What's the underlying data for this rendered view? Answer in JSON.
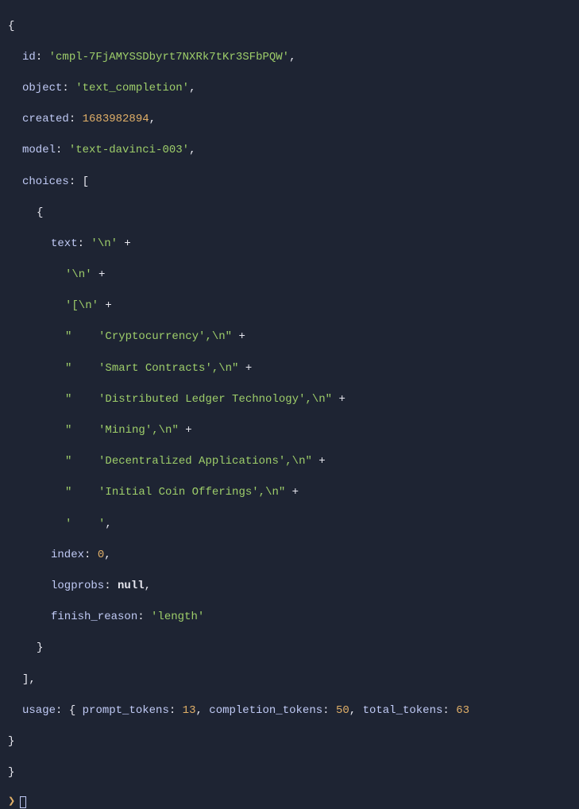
{
  "response": {
    "id_key": "id",
    "id_val": "'cmpl-7FjAMYSSDbyrt7NXRk7tKr3SFbPQW'",
    "object_key": "object",
    "object_val": "'text_completion'",
    "created_key": "created",
    "created_val": "1683982894",
    "model_key": "model",
    "model_val": "'text-davinci-003'",
    "choices_key": "choices",
    "choice": {
      "text_key": "text",
      "text_frag0": "'\\n'",
      "plus": " + ",
      "plus_trail": " +",
      "text_frag1": "'\\n'",
      "text_frag2": "'[\\n'",
      "text_line1a": "\"    '",
      "text_line1b": "Cryptocurrency",
      "text_line1c": "',\\n\"",
      "text_line2a": "\"    '",
      "text_line2b": "Smart Contracts",
      "text_line2c": "',\\n\"",
      "text_line3a": "\"    '",
      "text_line3b": "Distributed Ledger Technology",
      "text_line3c": "',\\n\"",
      "text_line4a": "\"    '",
      "text_line4b": "Mining",
      "text_line4c": "',\\n\"",
      "text_line5a": "\"    '",
      "text_line5b": "Decentralized Applications",
      "text_line5c": "',\\n\"",
      "text_line6a": "\"    '",
      "text_line6b": "Initial Coin Offerings",
      "text_line6c": "',\\n\"",
      "text_line7": "'    '",
      "index_key": "index",
      "index_val": "0",
      "logprobs_key": "logprobs",
      "logprobs_val": "null",
      "finish_reason_key": "finish_reason",
      "finish_reason_val": "'length'"
    },
    "usage_key": "usage",
    "usage": {
      "prompt_tokens_key": "prompt_tokens",
      "prompt_tokens_val": "13",
      "completion_tokens_key": "completion_tokens",
      "completion_tokens_val": "50",
      "total_tokens_key": "total_tokens",
      "total_tokens_val": "63"
    }
  },
  "symbols": {
    "open_brace": "{",
    "close_brace": "}",
    "open_bracket": "[",
    "close_bracket": "]",
    "colon": ": ",
    "comma": ",",
    "space": " ",
    "close_brace_comma": "},"
  },
  "prompt": {
    "marker": "❯"
  }
}
